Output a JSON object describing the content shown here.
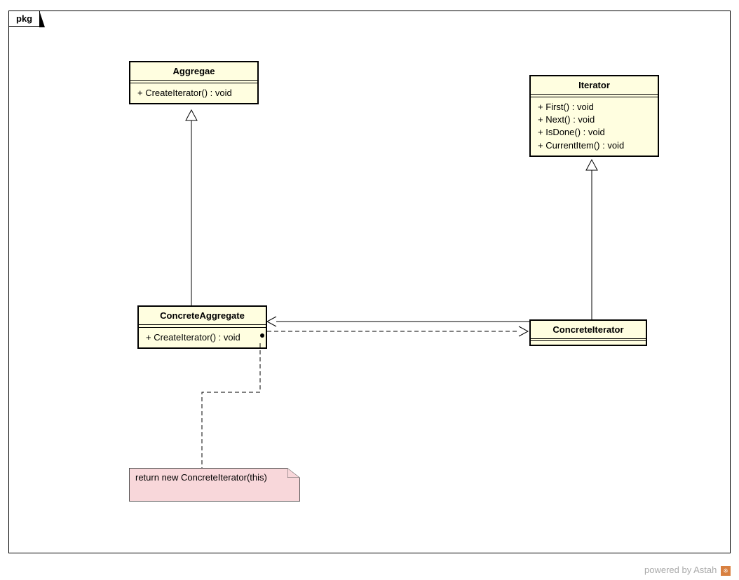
{
  "package": {
    "label": "pkg"
  },
  "classes": {
    "aggregate": {
      "name": "Aggregae",
      "method1": "+ CreateIterator() : void"
    },
    "iterator": {
      "name": "Iterator",
      "method1": "+ First() : void",
      "method2": "+ Next() : void",
      "method3": "+ IsDone() : void",
      "method4": "+ CurrentItem() : void"
    },
    "concreteAggregate": {
      "name": "ConcreteAggregate",
      "method1": "+ CreateIterator() : void"
    },
    "concreteIterator": {
      "name": "ConcreteIterator"
    }
  },
  "note": {
    "text": "return new ConcreteIterator(this)"
  },
  "credit": {
    "text": "powered by Astah",
    "badge": "※"
  }
}
